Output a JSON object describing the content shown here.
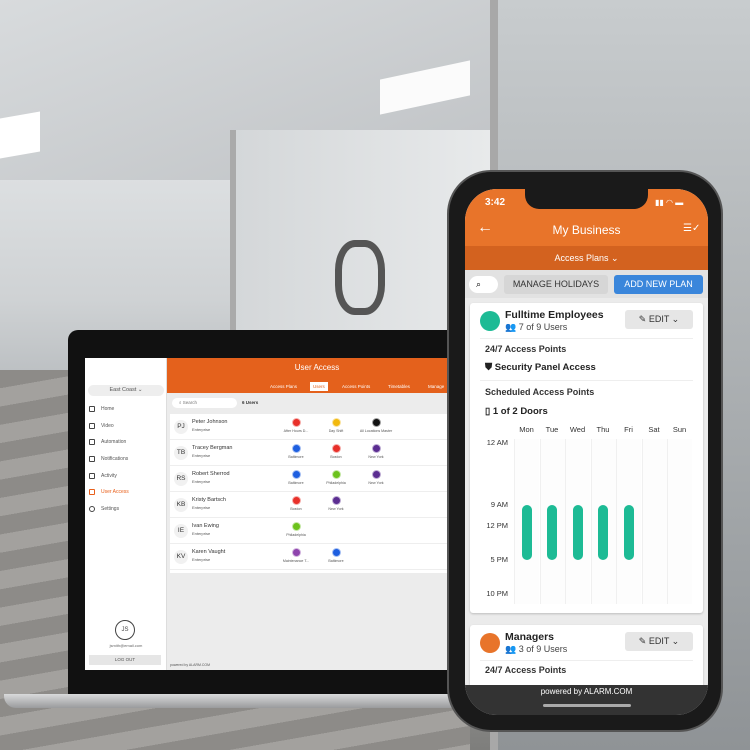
{
  "laptop": {
    "sidebar": {
      "location": "East Coast",
      "items": [
        "Home",
        "Video",
        "Automation",
        "Notifications",
        "Activity",
        "User Access",
        "Settings"
      ],
      "active": "User Access",
      "user_initials": "JS",
      "email": "jsmith@email.com",
      "logout": "LOG OUT"
    },
    "header": {
      "title": "User Access",
      "tabs": [
        "Access Plans",
        "Users",
        "Access Points",
        "Timetables",
        "Manage"
      ],
      "active_tab": "Users"
    },
    "search_placeholder": "Search",
    "user_count": "6 Users",
    "users": [
      {
        "initials": "PJ",
        "name": "Peter Johnson",
        "role": "Enterprise",
        "plans": [
          {
            "label": "After Hours D...",
            "color": "#e8302a"
          },
          {
            "label": "Day Shift",
            "color": "#f2b90f"
          },
          {
            "label": "All Locations Master",
            "color": "#111111"
          }
        ]
      },
      {
        "initials": "TB",
        "name": "Tracey Bergman",
        "role": "Enterprise",
        "plans": [
          {
            "label": "Baltimore",
            "color": "#1e5fe0"
          },
          {
            "label": "Boston",
            "color": "#e8302a"
          },
          {
            "label": "New York",
            "color": "#5b2d91"
          }
        ]
      },
      {
        "initials": "RS",
        "name": "Robert Sherrod",
        "role": "Enterprise",
        "plans": [
          {
            "label": "Baltimore",
            "color": "#1e5fe0"
          },
          {
            "label": "Philadelphia",
            "color": "#6cc21c"
          },
          {
            "label": "New York",
            "color": "#5b2d91"
          }
        ]
      },
      {
        "initials": "KB",
        "name": "Kristy Bartsch",
        "role": "Enterprise",
        "plans": [
          {
            "label": "Boston",
            "color": "#e8302a"
          },
          {
            "label": "New York",
            "color": "#5b2d91"
          }
        ]
      },
      {
        "initials": "IE",
        "name": "Ivan Ewing",
        "role": "Enterprise",
        "plans": [
          {
            "label": "Philadelphia",
            "color": "#6cc21c"
          }
        ]
      },
      {
        "initials": "KV",
        "name": "Karen Vaught",
        "role": "Enterprise",
        "plans": [
          {
            "label": "Maintenance T...",
            "color": "#8e44ad"
          },
          {
            "label": "Baltimore",
            "color": "#1e5fe0"
          }
        ]
      }
    ],
    "powered_by": "powered by ALARM.COM"
  },
  "phone": {
    "time": "3:42",
    "title": "My Business",
    "subtitle": "Access Plans",
    "manage_holidays": "MANAGE HOLIDAYS",
    "add_new_plan": "ADD NEW PLAN",
    "plans": [
      {
        "name": "Fulltime Employees",
        "users": "7 of 9 Users",
        "edit": "EDIT",
        "color": "#1dbb95",
        "section_247": "24/7 Access Points",
        "access_247": "Security Panel Access",
        "section_sched": "Scheduled Access Points",
        "scheduled": "1 of 2 Doors",
        "days": [
          "Mon",
          "Tue",
          "Wed",
          "Thu",
          "Fri",
          "Sat",
          "Sun"
        ],
        "time_labels": [
          "12 AM",
          "9 AM",
          "12 PM",
          "5 PM",
          "10 PM"
        ],
        "schedule": [
          {
            "day": "Mon",
            "start": "9 AM",
            "end": "5 PM"
          },
          {
            "day": "Tue",
            "start": "9 AM",
            "end": "5 PM"
          },
          {
            "day": "Wed",
            "start": "9 AM",
            "end": "5 PM"
          },
          {
            "day": "Thu",
            "start": "9 AM",
            "end": "5 PM"
          },
          {
            "day": "Fri",
            "start": "9 AM",
            "end": "5 PM"
          }
        ]
      },
      {
        "name": "Managers",
        "users": "3 of 9 Users",
        "edit": "EDIT",
        "color": "#e8742a",
        "section_247": "24/7 Access Points"
      }
    ],
    "powered_by": "powered by ALARM.COM",
    "accent": "#e8742a"
  }
}
